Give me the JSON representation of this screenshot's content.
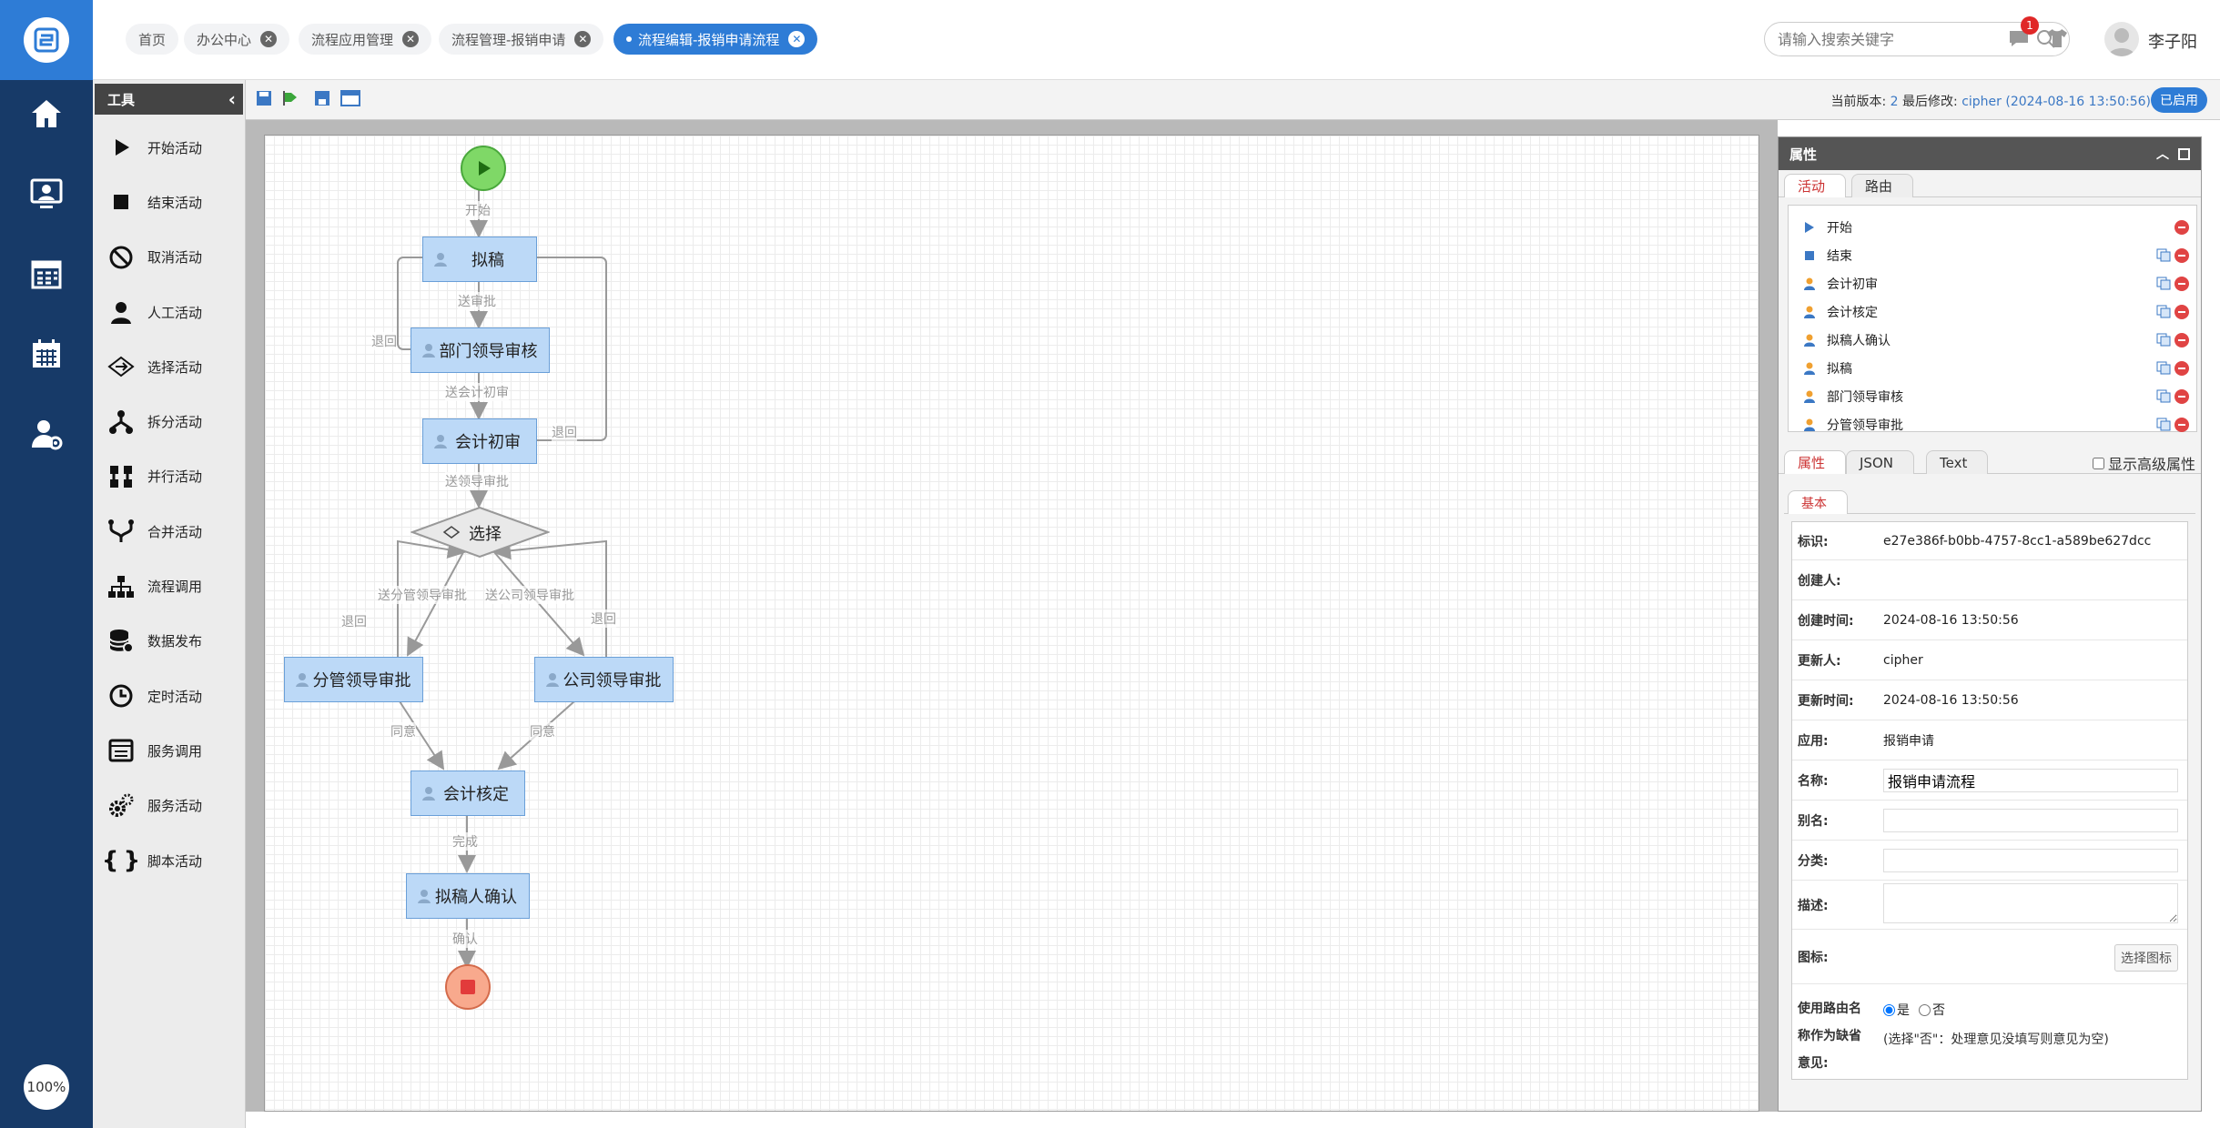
{
  "app": {
    "zoom": "100%"
  },
  "nav": {
    "icons": [
      "home-icon",
      "monitor-user-icon",
      "calendar-grid-icon",
      "calendar-icon",
      "user-settings-icon"
    ]
  },
  "tabs": [
    {
      "label": "首页"
    },
    {
      "label": "办公中心"
    },
    {
      "label": "流程应用管理"
    },
    {
      "label": "流程管理-报销申请"
    },
    {
      "label": "流程编辑-报销申请流程"
    }
  ],
  "header": {
    "search_placeholder": "请输入搜索关键字",
    "notification_count": "1",
    "user_name": "李子阳"
  },
  "toolbox": {
    "title": "工具",
    "items": [
      {
        "label": "开始活动",
        "icon": "play-icon"
      },
      {
        "label": "结束活动",
        "icon": "stop-icon"
      },
      {
        "label": "取消活动",
        "icon": "cancel-icon"
      },
      {
        "label": "人工活动",
        "icon": "person-icon"
      },
      {
        "label": "选择活动",
        "icon": "choice-icon"
      },
      {
        "label": "拆分活动",
        "icon": "split-icon"
      },
      {
        "label": "并行活动",
        "icon": "parallel-icon"
      },
      {
        "label": "合并活动",
        "icon": "merge-icon"
      },
      {
        "label": "流程调用",
        "icon": "hierarchy-icon"
      },
      {
        "label": "数据发布",
        "icon": "database-icon"
      },
      {
        "label": "定时活动",
        "icon": "clock-icon"
      },
      {
        "label": "服务调用",
        "icon": "service-call-icon"
      },
      {
        "label": "服务活动",
        "icon": "gears-icon"
      },
      {
        "label": "脚本活动",
        "icon": "braces-icon"
      }
    ]
  },
  "version": {
    "label": "当前版本:",
    "number": "2",
    "modified_label": "最后修改:",
    "modified_by": "cipher",
    "modified_time": "(2024-08-16 13:50:56)",
    "status": "已启用"
  },
  "diagram": {
    "nodes": {
      "draft": "拟稿",
      "dept": "部门领导审核",
      "acct_first": "会计初审",
      "choice": "选择",
      "branch_lead": "分管领导审批",
      "company_lead": "公司领导审批",
      "acct_final": "会计核定",
      "confirm": "拟稿人确认"
    },
    "edges": {
      "start": "开始",
      "submit": "送审批",
      "to_acct": "送会计初审",
      "to_lead": "送领导审批",
      "back1": "退回",
      "back2": "退回",
      "back3": "退回",
      "back4": "退回",
      "to_branch": "送分管领导审批",
      "to_company": "送公司领导审批",
      "agree1": "同意",
      "agree2": "同意",
      "done": "完成",
      "confirm": "确认"
    }
  },
  "props": {
    "title": "属性",
    "tabs": [
      "活动",
      "路由"
    ],
    "activities": [
      {
        "label": "开始",
        "icon": "start-icon"
      },
      {
        "label": "结束",
        "icon": "end-icon"
      },
      {
        "label": "会计初审",
        "icon": "person-icon"
      },
      {
        "label": "会计核定",
        "icon": "person-icon"
      },
      {
        "label": "拟稿人确认",
        "icon": "person-icon"
      },
      {
        "label": "拟稿",
        "icon": "person-icon"
      },
      {
        "label": "部门领导审核",
        "icon": "person-icon"
      },
      {
        "label": "分管领导审批",
        "icon": "person-icon"
      }
    ],
    "lower_tabs": [
      "属性",
      "JSON",
      "Text"
    ],
    "advanced": "显示高级属性",
    "section": "基本",
    "fields": {
      "id_label": "标识:",
      "id": "e27e386f-b0bb-4757-8cc1-a589be627dcc",
      "creator_label": "创建人:",
      "creator": "",
      "created_label": "创建时间:",
      "created": "2024-08-16 13:50:56",
      "updater_label": "更新人:",
      "updater": "cipher",
      "updated_label": "更新时间:",
      "updated": "2024-08-16 13:50:56",
      "app_label": "应用:",
      "app": "报销申请",
      "name_label": "名称:",
      "name": "报销申请流程",
      "alias_label": "别名:",
      "alias": "",
      "category_label": "分类:",
      "category": "",
      "desc_label": "描述:",
      "desc": "",
      "icon_label": "图标:",
      "icon_button": "选择图标",
      "route_label_1": "使用路由名",
      "route_label_2": "称作为缺省",
      "route_label_3": "意见:",
      "yes": "是",
      "no": "否",
      "route_note": "(选择\"否\"：处理意见没填写则意见为空)"
    }
  }
}
